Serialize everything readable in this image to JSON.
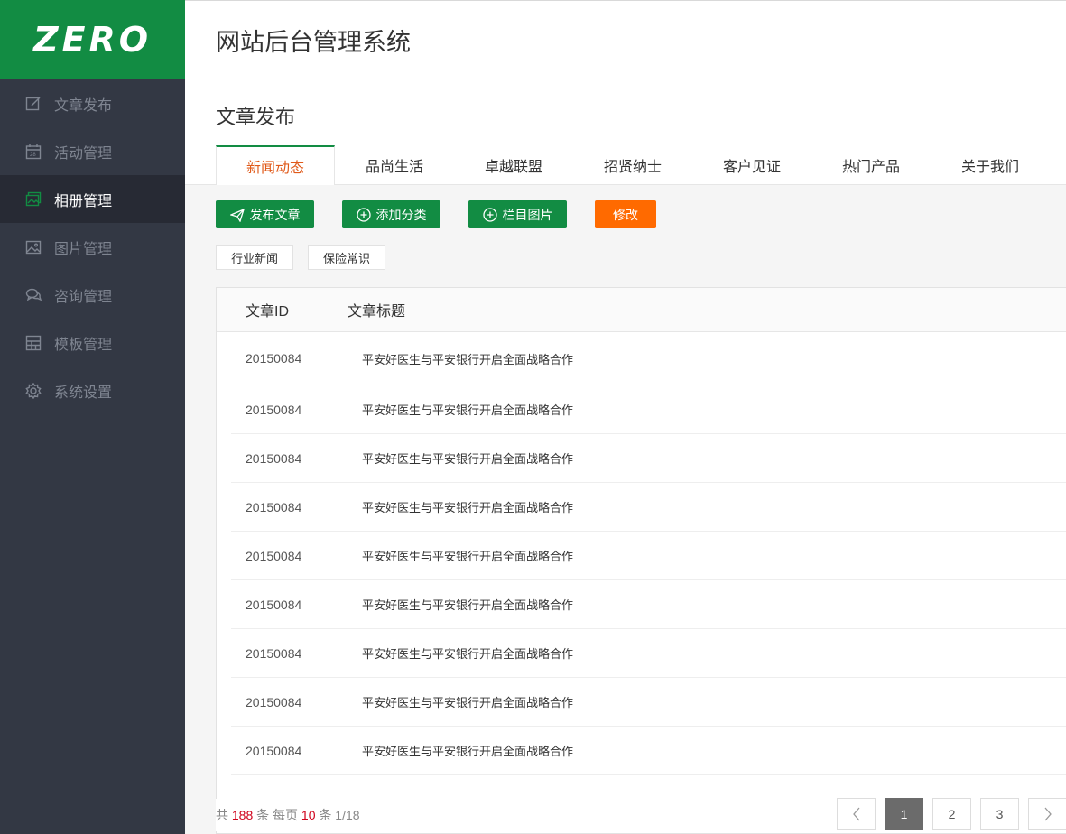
{
  "logo": "ZERO",
  "header": {
    "title": "网站后台管理系统"
  },
  "sidebar": {
    "items": [
      {
        "label": "文章发布",
        "icon": "edit-icon"
      },
      {
        "label": "活动管理",
        "icon": "calendar-icon"
      },
      {
        "label": "相册管理",
        "icon": "album-icon",
        "active": true
      },
      {
        "label": "图片管理",
        "icon": "image-icon"
      },
      {
        "label": "咨询管理",
        "icon": "chat-icon"
      },
      {
        "label": "模板管理",
        "icon": "layout-icon"
      },
      {
        "label": "系统设置",
        "icon": "gear-icon"
      }
    ]
  },
  "main": {
    "page_title": "文章发布",
    "tabs": [
      "新闻动态",
      "品尚生活",
      "卓越联盟",
      "招贤纳士",
      "客户见证",
      "热门产品",
      "关于我们"
    ],
    "buttons": {
      "publish": "发布文章",
      "add_category": "添加分类",
      "column_image": "栏目图片",
      "edit": "修改"
    },
    "categories": [
      "行业新闻",
      "保险常识"
    ],
    "table": {
      "headers": {
        "id": "文章ID",
        "title": "文章标题"
      },
      "rows": [
        {
          "id": "20150084",
          "title": "平安好医生与平安银行开启全面战略合作"
        },
        {
          "id": "20150084",
          "title": "平安好医生与平安银行开启全面战略合作"
        },
        {
          "id": "20150084",
          "title": "平安好医生与平安银行开启全面战略合作"
        },
        {
          "id": "20150084",
          "title": "平安好医生与平安银行开启全面战略合作"
        },
        {
          "id": "20150084",
          "title": "平安好医生与平安银行开启全面战略合作"
        },
        {
          "id": "20150084",
          "title": "平安好医生与平安银行开启全面战略合作"
        },
        {
          "id": "20150084",
          "title": "平安好医生与平安银行开启全面战略合作"
        },
        {
          "id": "20150084",
          "title": "平安好医生与平安银行开启全面战略合作"
        },
        {
          "id": "20150084",
          "title": "平安好医生与平安银行开启全面战略合作"
        }
      ]
    },
    "footer": {
      "total_prefix": "共",
      "total": "188",
      "total_suffix": "条 每页",
      "per_page": "10",
      "per_page_suffix": "条 1/18"
    },
    "pagination": {
      "pages": [
        "1",
        "2",
        "3"
      ],
      "current": "1"
    }
  },
  "colors": {
    "brand": "#128c43",
    "accent": "#ff6a00",
    "sidebar": "#333844"
  }
}
